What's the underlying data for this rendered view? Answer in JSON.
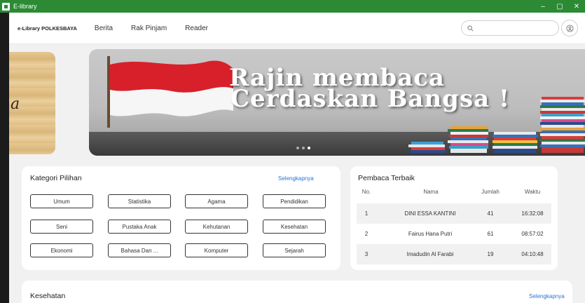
{
  "window": {
    "title": "E-library",
    "controls": [
      "–",
      "▢",
      "✕"
    ]
  },
  "navbar": {
    "brand": "e-Library POLKESBAYA",
    "links": [
      "Berita",
      "Rak Pinjam",
      "Reader"
    ],
    "search_placeholder": "",
    "icons": {
      "search": "search-icon",
      "user": "user-icon"
    }
  },
  "carousel": {
    "prev_slide_letter": "a",
    "headline_line1": "Rajin membaca",
    "headline_line2": "Cerdaskan Bangsa !",
    "dots": 3,
    "active_dot": 2
  },
  "kategori": {
    "title": "Kategori Pilihan",
    "more": "Selengkapnya",
    "items": [
      "Umum",
      "Statistika",
      "Agama",
      "Pendidikan",
      "Seni",
      "Pustaka Anak",
      "Kehutanan",
      "Kesehatan",
      "Ekonomi",
      "Bahasa Dan ...",
      "Komputer",
      "Sejarah"
    ]
  },
  "pembaca": {
    "title": "Pembaca Terbaik",
    "headers": [
      "No.",
      "Nama",
      "Jumlah",
      "Waktu"
    ],
    "rows": [
      {
        "no": "1",
        "nama": "DINI ESSA KANTINI",
        "jumlah": "41",
        "waktu": "16:32:08"
      },
      {
        "no": "2",
        "nama": "Fairus Hana Putri",
        "jumlah": "61",
        "waktu": "08:57:02"
      },
      {
        "no": "3",
        "nama": "Imadudin Al Farabi",
        "jumlah": "19",
        "waktu": "04:10:48"
      }
    ]
  },
  "kesehatan": {
    "title": "Kesehatan",
    "more": "Selengkapnya"
  },
  "colors": {
    "titlebar": "#2c8a35",
    "link": "#2a73d9",
    "background": "#f1f1f1"
  }
}
